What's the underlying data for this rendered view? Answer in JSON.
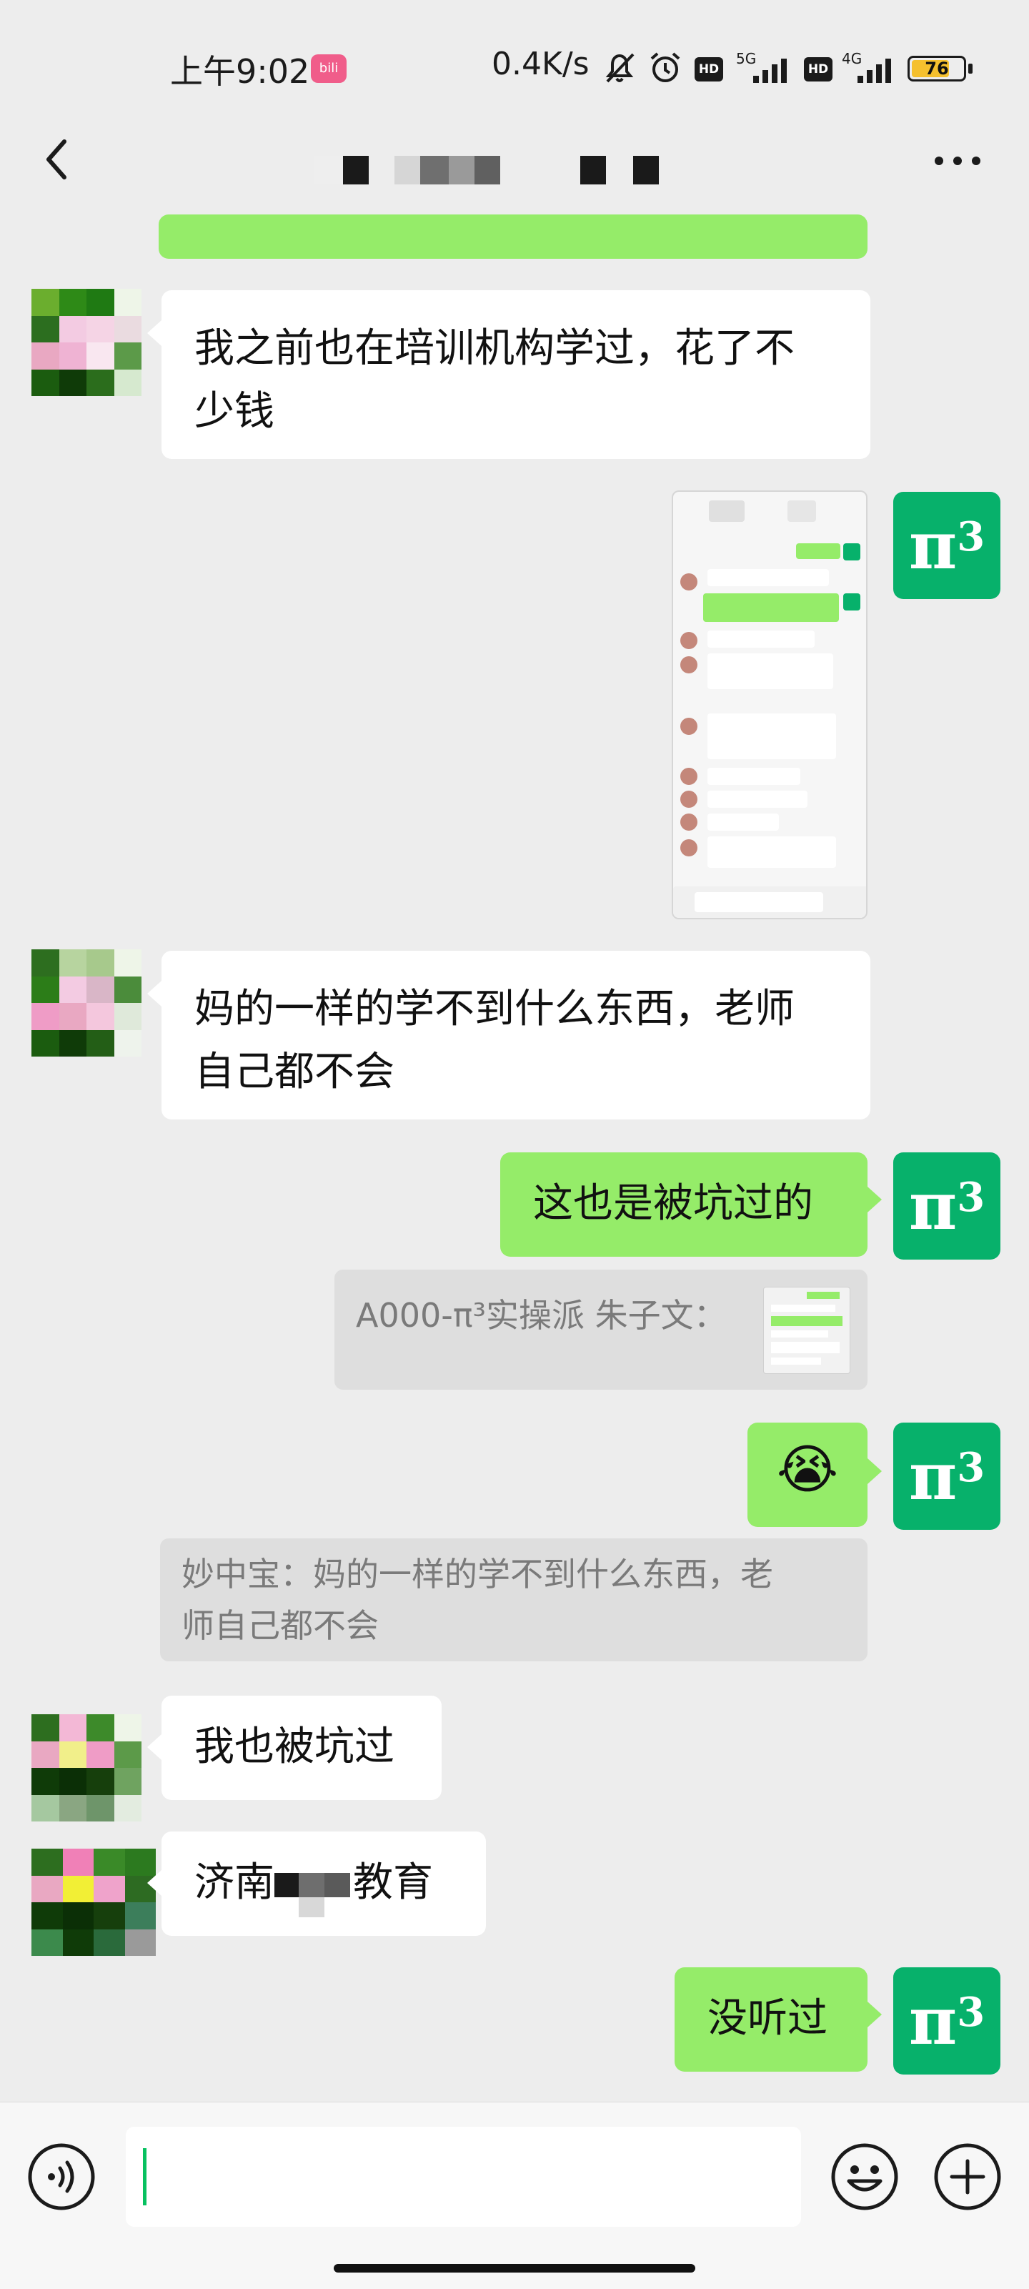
{
  "status_bar": {
    "time": "上午9:02",
    "app_badge": "bili",
    "net_speed": "0.4K/s",
    "sim1_type": "5G",
    "sim2_type": "4G",
    "hd_label": "HD",
    "battery_level": 76,
    "battery_text": "76"
  },
  "nav": {
    "back_icon": "chevron-left-icon",
    "more_icon": "more-dots-icon"
  },
  "messages": {
    "m1": "我之前也在培训机构学过，花了不少钱",
    "m1_line1": "我之前也在培训机构学过，花了不",
    "m1_line2": "少钱",
    "m3_line1": "妈的一样的学不到什么东西，老师",
    "m3_line2": "自己都不会",
    "m4": "这也是被坑过的",
    "m5_quote": "A000-π³实操派 朱子文：",
    "m6_emoji": "😭",
    "m7_quote_line1": "妙中宝：妈的一样的学不到什么东西，老",
    "m7_quote_line2": "师自己都不会",
    "m8": "我也被坑过",
    "m9_start": "济南",
    "m9_end": "教育",
    "m10": "没听过"
  },
  "me_avatar": {
    "symbol": "π",
    "sup": "3",
    "color": "#07b16b"
  },
  "screenshot_bubble": {
    "label": "image-attachment"
  },
  "input_bar": {
    "voice_icon": "voice-icon",
    "emoji_icon": "emoji-icon",
    "plus_icon": "plus-icon",
    "text_value": ""
  },
  "colors": {
    "background": "#ededed",
    "bubble_me": "#95ec69",
    "bubble_other": "#ffffff",
    "quote_bg": "#dedede",
    "accent": "#07c160"
  }
}
